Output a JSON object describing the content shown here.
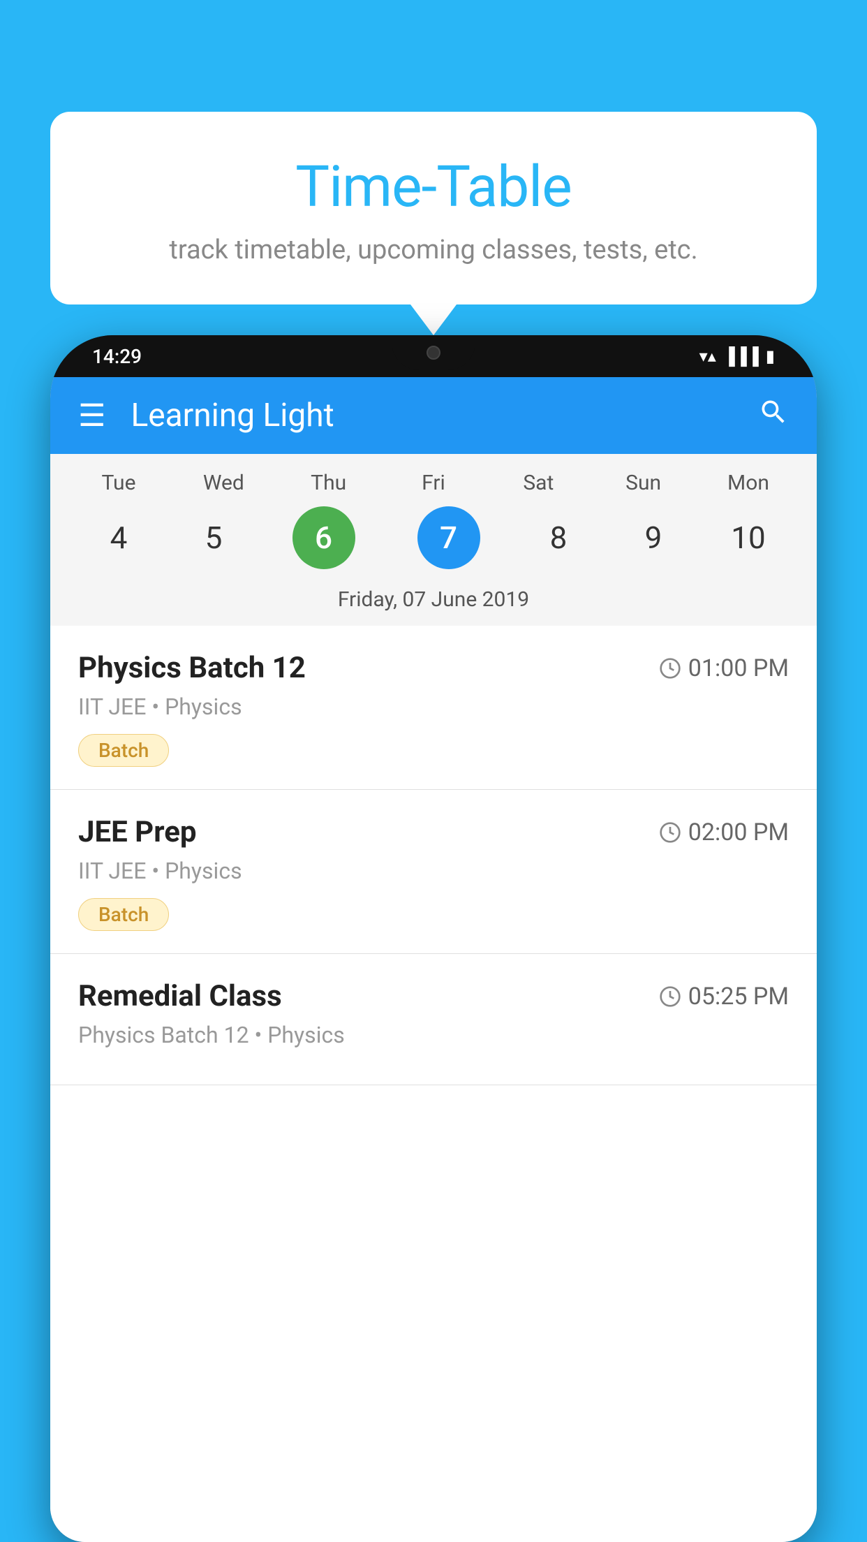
{
  "background": "#29b6f6",
  "tooltip": {
    "title": "Time-Table",
    "subtitle": "track timetable, upcoming classes, tests, etc."
  },
  "phone": {
    "time": "14:29",
    "toolbar": {
      "title": "Learning Light"
    },
    "calendar": {
      "days": [
        {
          "label": "Tue",
          "number": "4"
        },
        {
          "label": "Wed",
          "number": "5"
        },
        {
          "label": "Thu",
          "number": "6",
          "state": "today"
        },
        {
          "label": "Fri",
          "number": "7",
          "state": "selected"
        },
        {
          "label": "Sat",
          "number": "8"
        },
        {
          "label": "Sun",
          "number": "9"
        },
        {
          "label": "Mon",
          "number": "10"
        }
      ],
      "selectedDate": "Friday, 07 June 2019"
    },
    "schedule": [
      {
        "title": "Physics Batch 12",
        "time": "01:00 PM",
        "sub": "IIT JEE • Physics",
        "badge": "Batch"
      },
      {
        "title": "JEE Prep",
        "time": "02:00 PM",
        "sub": "IIT JEE • Physics",
        "badge": "Batch"
      },
      {
        "title": "Remedial Class",
        "time": "05:25 PM",
        "sub": "Physics Batch 12 • Physics",
        "badge": null
      }
    ]
  },
  "icons": {
    "hamburger": "≡",
    "search": "🔍",
    "clock": "🕐"
  }
}
